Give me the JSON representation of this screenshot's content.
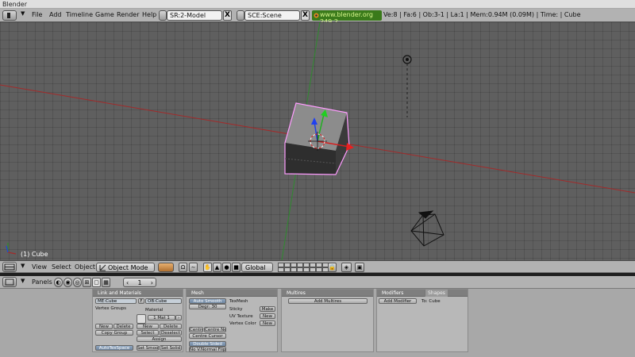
{
  "window": {
    "title": "Blender"
  },
  "top_header": {
    "menus": [
      "File",
      "Add",
      "Timeline",
      "Game",
      "Render",
      "Help"
    ],
    "screen_field": "SR:2-Model",
    "scene_field": "SCE:Scene",
    "url": "www.blender.org 249.2",
    "stats": "Ve:8 | Fa:6 | Ob:3-1 | La:1   | Mem:0.94M (0.09M)  | Time: | Cube",
    "close_glyph": "X"
  },
  "viewport": {
    "object_label": "(1) Cube",
    "colors": {
      "x_axis": "#a32a2a",
      "y_axis": "#2e8a2e",
      "selection": "#ff9cff"
    }
  },
  "view_header": {
    "menus": [
      "View",
      "Select",
      "Object"
    ],
    "mode": "Object Mode",
    "orientation": "Global"
  },
  "buttons_header": {
    "panels_label": "Panels",
    "page_number": "1"
  },
  "panels": {
    "link_materials": {
      "title": "Link and Materials",
      "mesh_name": "ME:Cube",
      "f_label": "F",
      "ob_name": "OB:Cube",
      "vertex_groups": "Vertex Groups",
      "material": "Material",
      "mat_count": "1 Mat 1",
      "new": "New",
      "delete": "Delete",
      "copy_group": "Copy Group",
      "select": "Select",
      "deselect": "Deselect",
      "assign": "Assign",
      "autotexspace": "AutoTexSpace",
      "set_smooth": "Set Smooth",
      "set_solid": "Set Solid"
    },
    "mesh": {
      "title": "Mesh",
      "auto_smooth": "Auto Smooth",
      "degr": "Degr: 30",
      "texmesh": "TexMesh",
      "sticky": "Sticky",
      "make": "Make",
      "uv_texture": "UV Texture",
      "vertex_color": "Vertex Color",
      "new": "New",
      "centre": "Centre",
      "centre_new": "Centre New",
      "centre_cursor": "Centre Cursor",
      "double_sided": "Double Sided",
      "no_vnormal_flip": "No V.Normal Flip"
    },
    "multires": {
      "title": "Multires",
      "add_multires": "Add Multires"
    },
    "modifiers": {
      "title": "Modifiers",
      "tab_shapes": "Shapes",
      "add_modifier": "Add Modifier",
      "to_label": "To: Cube"
    }
  }
}
